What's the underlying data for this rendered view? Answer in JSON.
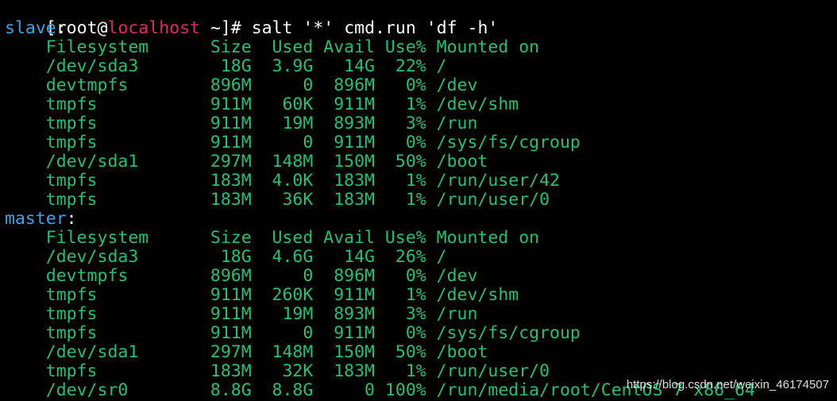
{
  "prompt": {
    "open": "[",
    "user": "root",
    "at": "@",
    "host": "localhost",
    "rest": " ~]# ",
    "command": "salt '*' cmd.run 'df -h'"
  },
  "colors": {
    "background": "#000000",
    "prompt_text": "#ffffff",
    "host": "#e3266f",
    "minion_name": "#3aa5e6",
    "output": "#21c278"
  },
  "minions": [
    {
      "name": "slave",
      "lines": [
        "    Filesystem      Size  Used Avail Use% Mounted on",
        "    /dev/sda3        18G  3.9G   14G  22% /",
        "    devtmpfs        896M     0  896M   0% /dev",
        "    tmpfs           911M   60K  911M   1% /dev/shm",
        "    tmpfs           911M   19M  893M   3% /run",
        "    tmpfs           911M     0  911M   0% /sys/fs/cgroup",
        "    /dev/sda1       297M  148M  150M  50% /boot",
        "    tmpfs           183M  4.0K  183M   1% /run/user/42",
        "    tmpfs           183M   36K  183M   1% /run/user/0"
      ]
    },
    {
      "name": "master",
      "lines": [
        "    Filesystem      Size  Used Avail Use% Mounted on",
        "    /dev/sda3        18G  4.6G   14G  26% /",
        "    devtmpfs        896M     0  896M   0% /dev",
        "    tmpfs           911M  260K  911M   1% /dev/shm",
        "    tmpfs           911M   19M  893M   3% /run",
        "    tmpfs           911M     0  911M   0% /sys/fs/cgroup",
        "    /dev/sda1       297M  148M  150M  50% /boot",
        "    tmpfs           183M   32K  183M   1% /run/user/0",
        "    /dev/sr0        8.8G  8.8G     0 100% /run/media/root/CentOS 7 x86_64"
      ]
    }
  ],
  "watermark": "https://blog.csdn.net/weixin_46174507"
}
